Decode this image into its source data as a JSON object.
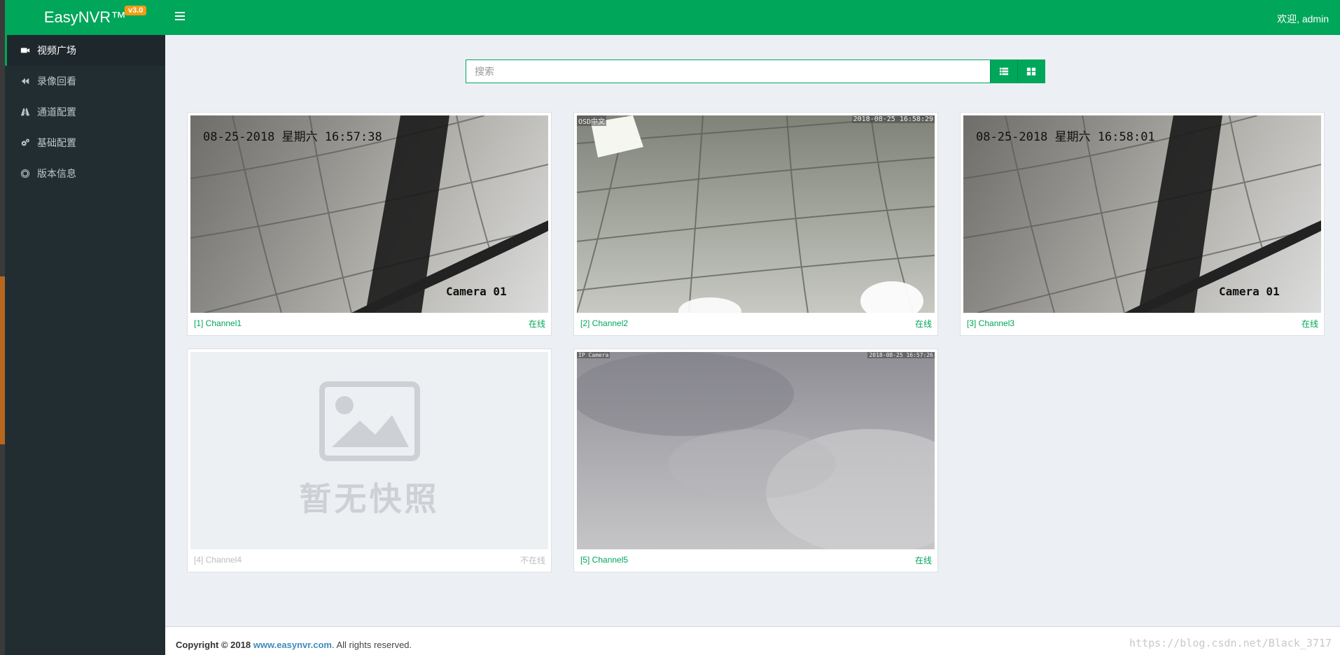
{
  "app": {
    "name": "EasyNVR™",
    "version": "v3.0"
  },
  "header": {
    "welcome": "欢迎, admin"
  },
  "sidebar": {
    "items": [
      {
        "label": "视频广场",
        "icon": "video-camera-icon",
        "active": true
      },
      {
        "label": "录像回看",
        "icon": "backward-icon",
        "active": false
      },
      {
        "label": "通道配置",
        "icon": "road-icon",
        "active": false
      },
      {
        "label": "基础配置",
        "icon": "cogs-icon",
        "active": false
      },
      {
        "label": "版本信息",
        "icon": "life-ring-icon",
        "active": false
      }
    ]
  },
  "search": {
    "placeholder": "搜索",
    "value": ""
  },
  "view_buttons": [
    {
      "icon": "list-view-icon"
    },
    {
      "icon": "grid-view-icon"
    }
  ],
  "channels": [
    {
      "name": "[1] Channel1",
      "status": "在线",
      "online": true,
      "osd_time": "08-25-2018 星期六 16:57:38",
      "osd_label": "Camera 01"
    },
    {
      "name": "[2] Channel2",
      "status": "在线",
      "online": true,
      "osd_title": "OSD中文",
      "osd_time": "2018-08-25 16:58:29"
    },
    {
      "name": "[3] Channel3",
      "status": "在线",
      "online": true,
      "osd_time": "08-25-2018 星期六 16:58:01",
      "osd_label": "Camera 01"
    },
    {
      "name": "[4] Channel4",
      "status": "不在线",
      "online": false,
      "placeholder_text": "暂无快照"
    },
    {
      "name": "[5] Channel5",
      "status": "在线",
      "online": true,
      "osd_title": "IP Camera",
      "osd_time": "2018-08-25 16:57:26"
    }
  ],
  "footer": {
    "copyright_prefix": "Copyright © 2018",
    "link": "www.easynvr.com",
    "suffix": ". All rights reserved.",
    "watermark": "https://blog.csdn.net/Black_3717"
  },
  "colors": {
    "primary": "#00a65a",
    "sidebar": "#222d32",
    "badge": "#f39c12",
    "link": "#3c8dbc"
  }
}
